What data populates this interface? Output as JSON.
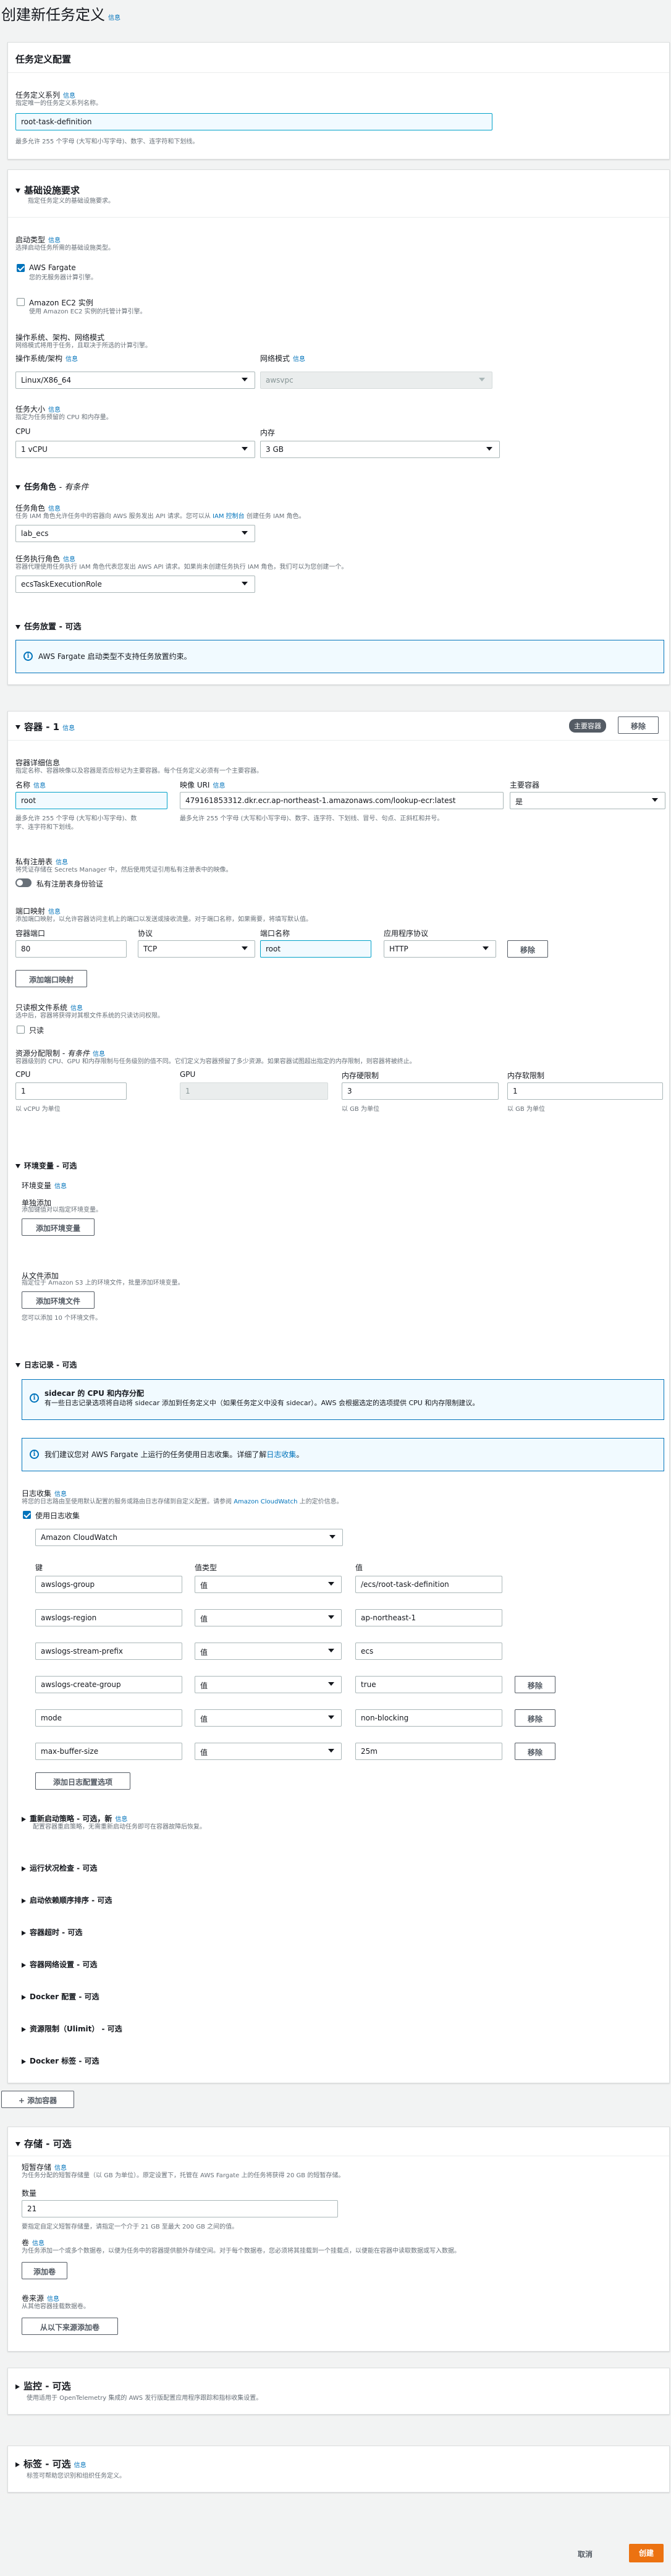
{
  "page": {
    "title": "创建新任务定义",
    "info": "信息"
  },
  "info": "信息",
  "s1": {
    "title": "任务定义配置",
    "family_label": "任务定义系列",
    "family_desc": "指定唯一的任务定义系列名称。",
    "family_value": "root-task-definition",
    "family_hint": "最多允许 255 个字母 (大写和小写字母)、数字、连字符和下划线。"
  },
  "s2": {
    "title": "基础设施要求",
    "desc": "指定任务定义的基础设施要求。",
    "launch_label": "启动类型",
    "launch_desc": "选择启动任务所需的基础设施类型。",
    "fargate_label": "AWS Fargate",
    "fargate_desc": "您的无服务器计算引擎。",
    "ec2_label": "Amazon EC2 实例",
    "ec2_desc": "使用 Amazon EC2 实例的托管计算引擎。",
    "os_section": "操作系统、架构、网络模式",
    "os_section_desc": "网络模式将用于任务，且取决于所选的计算引擎。",
    "os_label": "操作系统/架构",
    "os_value": "Linux/X86_64",
    "net_label": "网络模式",
    "net_value": "awsvpc",
    "size_label": "任务大小",
    "size_desc": "指定为任务预留的 CPU 和内存量。",
    "cpu_label": "CPU",
    "cpu_value": "1 vCPU",
    "mem_label": "内存",
    "mem_value": "3 GB",
    "roles_title": "任务角色",
    "roles_optional": "- 有条件",
    "task_role_label": "任务角色",
    "task_role_desc_a": "任务 IAM 角色允许任务中的容器向 AWS 服务发出 API 请求。您可以从",
    "task_role_link": "IAM 控制台",
    "task_role_desc_b": "创建任务 IAM 角色。",
    "task_role_value": "lab_ecs",
    "exec_role_label": "任务执行角色",
    "exec_role_desc": "容器代理使用任务执行 IAM 角色代表您发出 AWS API 请求。如果尚未创建任务执行 IAM 角色，我们可以为您创建一个。",
    "exec_role_value": "ecsTaskExecutionRole",
    "placement_title": "任务放置 - 可选",
    "placement_alert": "AWS Fargate 启动类型不支持任务放置约束。"
  },
  "s3": {
    "title": "容器 - 1",
    "badge": "主要容器",
    "remove": "移除",
    "details_label": "容器详细信息",
    "details_desc": "指定名称、容器映像以及容器是否应标记为主要容器。每个任务定义必须有一个主要容器。",
    "name_label": "名称",
    "name_value": "root",
    "name_hint1": "最多允许 255 个字母 (大写和小写字母)、数",
    "name_hint2": "字、连字符和下划线。",
    "image_label": "映像 URI",
    "image_value": "479161853312.dkr.ecr.ap-northeast-1.amazonaws.com/lookup-ecr:latest",
    "image_hint": "最多允许 255 个字母 (大写和小写字母)、数字、连字符、下划线、冒号、句点、正斜杠和井号。",
    "essential_label": "主要容器",
    "essential_value": "是",
    "registry_label": "私有注册表",
    "registry_desc": "将凭证存储在 Secrets Manager 中，然后使用凭证引用私有注册表中的映像。",
    "registry_toggle": "私有注册表身份验证",
    "port_label": "端口映射",
    "port_desc": "添加端口映射，以允许容器访问主机上的端口以发送或接收流量。对于端口名称，如果需要，将填写默认值。",
    "cport_label": "容器端口",
    "cport_value": "80",
    "proto_label": "协议",
    "proto_value": "TCP",
    "pname_label": "端口名称",
    "pname_value": "root",
    "app_label": "应用程序协议",
    "app_value": "HTTP",
    "port_remove": "移除",
    "add_port": "添加端口映射",
    "ro_label": "只读根文件系统",
    "ro_desc": "选中后，容器将获得对其根文件系统的只读访问权限。",
    "ro_cb": "只读",
    "limits_label": "资源分配限制",
    "limits_cond": "- 有条件",
    "limits_desc": "容器级别的 CPU、GPU 和内存限制与任务级别的值不同。它们定义为容器预留了多少资源。如果容器试图超出指定的内存限制，则容器将被终止。",
    "lcpu_label": "CPU",
    "lcpu_value": "1",
    "lcpu_hint": "以 vCPU 为单位",
    "gpu_label": "GPU",
    "gpu_value": "1",
    "hard_label": "内存硬限制",
    "hard_value": "3",
    "hard_hint": "以 GB 为单位",
    "soft_label": "内存软限制",
    "soft_value": "1",
    "soft_hint": "以 GB 为单位",
    "env_title": "环境变量 - 可选",
    "env_label": "环境变量",
    "single_label": "单独添加",
    "single_desc": "添加键值对以指定环境变量。",
    "add_env": "添加环境变量",
    "file_label": "从文件添加",
    "file_desc": "指定位于 Amazon S3 上的环境文件，批量添加环境变量。",
    "add_file": "添加环境文件",
    "file_hint": "您可以添加 10 个环境文件。",
    "log_title": "日志记录 - 可选",
    "sidecar_title": "sidecar 的 CPU 和内存分配",
    "sidecar_body": "有一些日志记录选项将自动将 sidecar 添加到任务定义中（如果任务定义中没有 sidecar）。AWS 会根据选定的选项提供 CPU 和内存限制建议。",
    "metrics_a": "我们建议您对 AWS Fargate 上运行的任务使用日志收集。详细了解",
    "metrics_link": "日志收集",
    "metrics_b": "。",
    "collect_label": "日志收集",
    "collect_desc_a": "将您的日志路由至使用默认配置的服务或路由日志存储到自定义配置。请参阅",
    "collect_link": "Amazon CloudWatch",
    "collect_desc_b": "上的定价信息。",
    "use_collect": "使用日志收集",
    "dest_value": "Amazon CloudWatch",
    "key_h": "键",
    "vtype_h": "值类型",
    "val_h": "值",
    "log_rows": [
      {
        "key": "awslogs-group",
        "type": "值",
        "value": "/ecs/root-task-definition",
        "remove": ""
      },
      {
        "key": "awslogs-region",
        "type": "值",
        "value": "ap-northeast-1",
        "remove": ""
      },
      {
        "key": "awslogs-stream-prefix",
        "type": "值",
        "value": "ecs",
        "remove": ""
      },
      {
        "key": "awslogs-create-group",
        "type": "值",
        "value": "true",
        "remove": "移除"
      },
      {
        "key": "mode",
        "type": "值",
        "value": "non-blocking",
        "remove": "移除"
      },
      {
        "key": "max-buffer-size",
        "type": "值",
        "value": "25m",
        "remove": "移除"
      }
    ],
    "add_log_opt": "添加日志配置选项",
    "restart_title": "重新启动策略 - 可选，新",
    "restart_desc": "配置容器重启策略，无需重新启动任务即可在容器故障后恢复。",
    "c1": "运行状况检查 - 可选",
    "c2": "启动依赖顺序排序 - 可选",
    "c3": "容器超时 - 可选",
    "c4": "容器网络设置 - 可选",
    "c5": "Docker 配置 - 可选",
    "c6": "资源限制（Ulimit） - 可选",
    "c7": "Docker 标签 - 可选"
  },
  "add_container": "添加容器",
  "s4": {
    "title": "存储 - 可选",
    "eph_label": "短暂存储",
    "eph_desc": "为任务分配的短暂存储量（以 GB 为单位）。原定设置下，托管在 AWS Fargate 上的任务将获得 20 GB 的短暂存储。",
    "qty_label": "数量",
    "qty_value": "21",
    "qty_hint": "要指定自定义短暂存储量，请指定一个介于 21 GB 至最大 200 GB 之间的值。",
    "vol_label": "卷",
    "vol_desc": "为任务添加一个或多个数据卷，以便为任务中的容器提供额外存储空间。对于每个数据卷，您必须将其挂载到一个挂载点，以便能在容器中读取数据或写入数据。",
    "add_vol": "添加卷",
    "from_label": "卷来源",
    "from_desc": "从其他容器挂载数据卷。",
    "add_from": "从以下来源添加卷"
  },
  "s5": {
    "title": "监控 - 可选",
    "desc": "使用适用于 OpenTelemetry 集成的 AWS 发行版配置应用程序跟踪和指标收集设置。"
  },
  "s6": {
    "title": "标签 - 可选",
    "desc": "标签可帮助您识别和组织任务定义。"
  },
  "footer": {
    "cancel": "取消",
    "create": "创建"
  },
  "colors": {
    "accent": "#0073bb",
    "primary": "#ec7211"
  }
}
